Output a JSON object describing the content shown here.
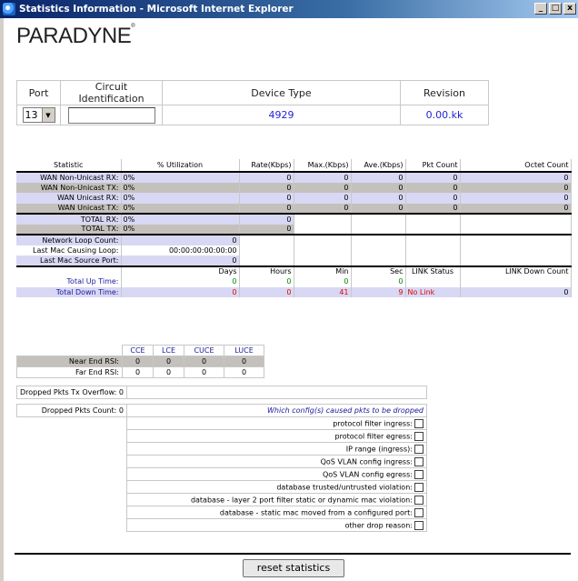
{
  "window": {
    "title": "Statistics Information - Microsoft Internet Explorer",
    "min": "_",
    "max": "□",
    "close": "x"
  },
  "logo": "PARADYNE",
  "port_table": {
    "headers": [
      "Port",
      "Circuit Identification",
      "Device Type",
      "Revision"
    ],
    "port_value": "13",
    "circuit_value": "",
    "device_type": "4929",
    "revision": "0.00.kk"
  },
  "stats": {
    "headers": [
      "Statistic",
      "% Utilization",
      "Rate(Kbps)",
      "Max.(Kbps)",
      "Ave.(Kbps)",
      "Pkt Count",
      "Octet Count"
    ],
    "rows": [
      {
        "label": "WAN Non-Unicast RX:",
        "util": "0%",
        "rate": "0",
        "max": "0",
        "ave": "0",
        "pkt": "0",
        "octet": "0"
      },
      {
        "label": "WAN Non-Unicast TX:",
        "util": "0%",
        "rate": "0",
        "max": "0",
        "ave": "0",
        "pkt": "0",
        "octet": "0"
      },
      {
        "label": "WAN Unicast RX:",
        "util": "0%",
        "rate": "0",
        "max": "0",
        "ave": "0",
        "pkt": "0",
        "octet": "0"
      },
      {
        "label": "WAN Unicast TX:",
        "util": "0%",
        "rate": "0",
        "max": "0",
        "ave": "0",
        "pkt": "0",
        "octet": "0"
      }
    ],
    "totals": [
      {
        "label": "TOTAL RX:",
        "util": "0%",
        "rate": "0"
      },
      {
        "label": "TOTAL TX:",
        "util": "0%",
        "rate": "0"
      }
    ],
    "loop": [
      {
        "label": "Network Loop Count:",
        "value": "0"
      },
      {
        "label": "Last Mac Causing Loop:",
        "value": "00:00:00:00:00:00"
      },
      {
        "label": "Last Mac Source Port:",
        "value": "0"
      }
    ],
    "time_headers": [
      "Days",
      "Hours",
      "Min",
      "Sec",
      "LINK Status",
      "LINK Down Count"
    ],
    "up": {
      "label": "Total Up Time:",
      "days": "0",
      "hours": "0",
      "min": "0",
      "sec": "0"
    },
    "down": {
      "label": "Total Down Time:",
      "days": "0",
      "hours": "0",
      "min": "41",
      "sec": "9",
      "link": "No Link",
      "down_count": "0"
    }
  },
  "rsi": {
    "headers": [
      "CCE",
      "LCE",
      "CUCE",
      "LUCE"
    ],
    "rows": [
      {
        "label": "Near End RSI:",
        "vals": [
          "0",
          "0",
          "0",
          "0"
        ]
      },
      {
        "label": "Far End RSI:",
        "vals": [
          "0",
          "0",
          "0",
          "0"
        ]
      }
    ]
  },
  "drops": {
    "overflow_label": "Dropped Pkts Tx Overflow:",
    "overflow_value": "0",
    "count_label": "Dropped Pkts Count:",
    "count_value": "0",
    "configs_header": "Which config(s) caused pkts to be dropped",
    "reasons": [
      "protocol filter ingress:",
      "protocol filter egress:",
      "IP range (ingress):",
      "QoS VLAN config ingress:",
      "QoS VLAN config egress:",
      "database trusted/untrusted violation:",
      "database - layer 2 port filter static or dynamic mac violation:",
      "database - static mac moved from a configured port:",
      "other drop reason:"
    ]
  },
  "reset_label": "reset statistics"
}
